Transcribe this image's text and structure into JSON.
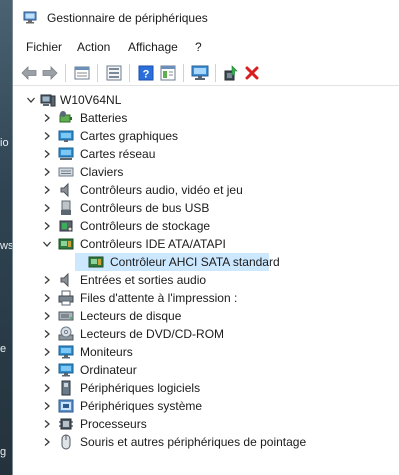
{
  "window": {
    "title": "Gestionnaire de périphériques"
  },
  "menu": [
    "Fichier",
    "Action",
    "Affichage",
    "?"
  ],
  "toolbar": {
    "buttons": [
      "back-arrow-icon",
      "forward-arrow-icon",
      "properties-icon",
      "console-tree-icon",
      "help-icon",
      "details-view-icon",
      "monitor-scan-icon",
      "update-driver-icon",
      "uninstall-x-icon"
    ]
  },
  "desktop": {
    "letters": [
      "io",
      "ws",
      "e",
      "g"
    ]
  },
  "tree": {
    "root": "W10V64NL",
    "items": [
      {
        "label": "Batteries",
        "icon": "battery-icon"
      },
      {
        "label": "Cartes graphiques",
        "icon": "display-adapter-icon"
      },
      {
        "label": "Cartes réseau",
        "icon": "network-adapter-icon"
      },
      {
        "label": "Claviers",
        "icon": "keyboard-icon"
      },
      {
        "label": "Contrôleurs audio, vidéo et jeu",
        "icon": "speaker-icon"
      },
      {
        "label": "Contrôleurs de bus USB",
        "icon": "usb-icon"
      },
      {
        "label": "Contrôleurs de stockage",
        "icon": "storage-controller-icon"
      },
      {
        "label": "Contrôleurs IDE ATA/ATAPI",
        "icon": "ide-controller-icon",
        "expanded": true
      },
      {
        "label": "Contrôleur AHCI SATA standard",
        "icon": "ahci-card-icon",
        "child": true,
        "selected": true
      },
      {
        "label": "Entrées et sorties audio",
        "icon": "audio-io-icon"
      },
      {
        "label": "Files d'attente à l'impression :",
        "icon": "printer-icon"
      },
      {
        "label": "Lecteurs de disque",
        "icon": "disk-drive-icon"
      },
      {
        "label": "Lecteurs de DVD/CD-ROM",
        "icon": "dvd-icon"
      },
      {
        "label": "Moniteurs",
        "icon": "monitor-icon"
      },
      {
        "label": "Ordinateur",
        "icon": "computer-icon"
      },
      {
        "label": "Périphériques logiciels",
        "icon": "software-device-icon"
      },
      {
        "label": "Périphériques système",
        "icon": "system-device-icon"
      },
      {
        "label": "Processeurs",
        "icon": "processor-icon"
      },
      {
        "label": "Souris et autres périphériques de pointage",
        "icon": "mouse-icon"
      }
    ]
  },
  "colors": {
    "selection": "#cce8ff",
    "accent": "#2a6fdb",
    "danger": "#d81e1e"
  }
}
